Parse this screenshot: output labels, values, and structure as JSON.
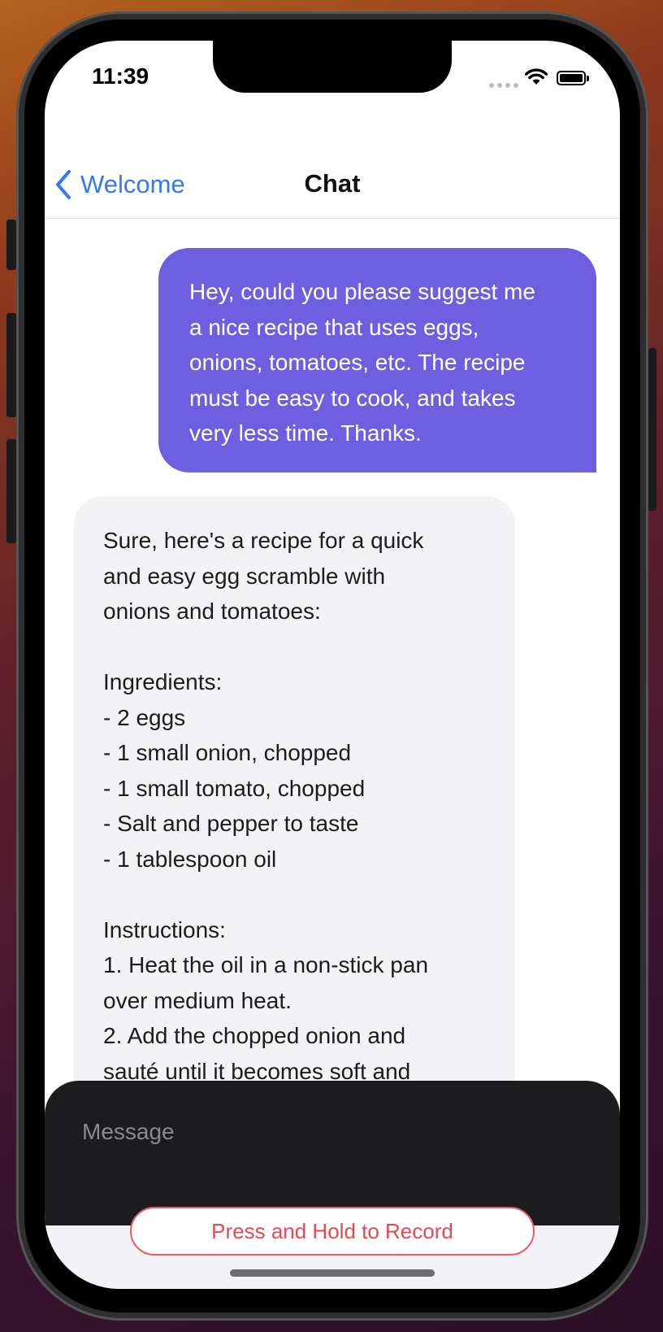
{
  "status_bar": {
    "time": "11:39"
  },
  "nav": {
    "back_label": "Welcome",
    "title": "Chat"
  },
  "messages": [
    {
      "role": "user",
      "text": "Hey, could you please suggest me\na nice recipe that uses eggs,\nonions, tomatoes, etc. The recipe\nmust be easy to cook, and takes\nvery less time. Thanks."
    },
    {
      "role": "assistant",
      "text": "Sure, here's a recipe for a quick\nand easy egg scramble with\nonions and tomatoes:\n\nIngredients:\n- 2 eggs\n- 1 small onion, chopped\n- 1 small tomato, chopped\n- Salt and pepper to taste\n- 1 tablespoon oil\n\nInstructions:\n1. Heat the oil in a non-stick pan\nover medium heat.\n2. Add the chopped onion and\nsauté until it becomes soft and"
    }
  ],
  "composer": {
    "placeholder": "Message"
  },
  "record_button": {
    "label": "Press and Hold to Record"
  },
  "colors": {
    "accent": "#3478f6",
    "user_bubble": "#6d5fe0",
    "assistant_bubble": "#f3f3f5",
    "record": "#e44a50"
  },
  "icons": [
    "chevron-left-icon",
    "wifi-icon",
    "battery-icon",
    "cellular-signal-icon"
  ]
}
